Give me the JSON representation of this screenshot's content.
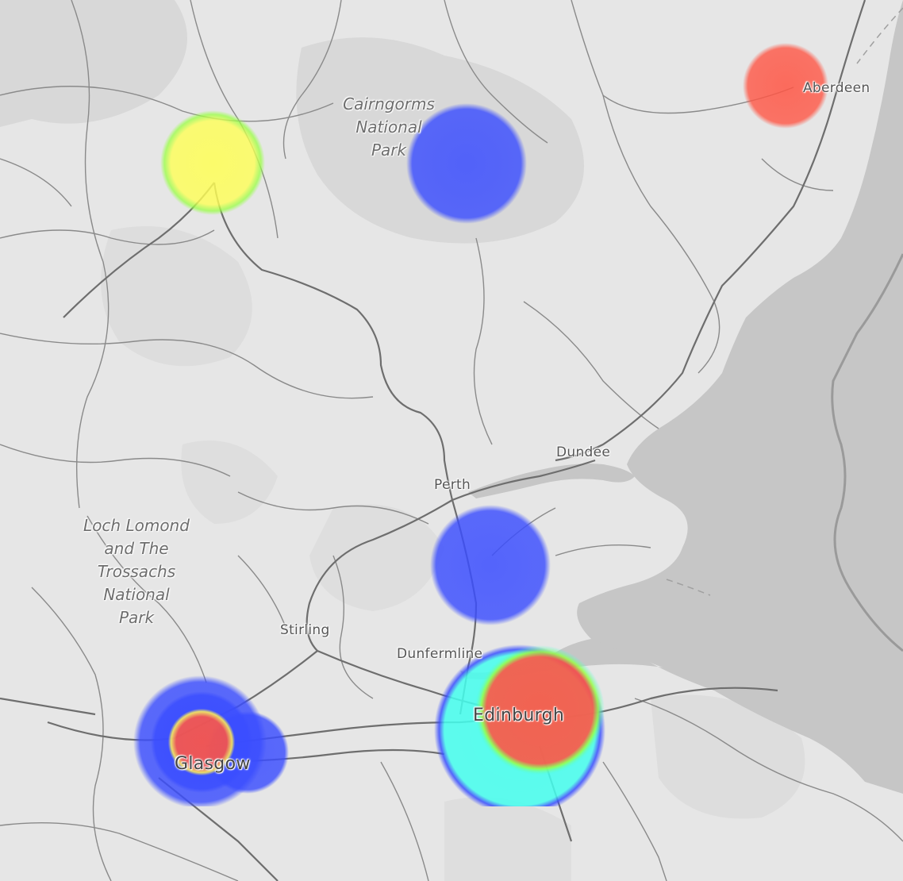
{
  "map": {
    "colors": {
      "land": "#e6e6e6",
      "sea": "#c6c6c6",
      "upland": "#d6d6d6",
      "road": "#8a8a8a",
      "motorway": "#666666",
      "heat_low": "#3a4dff",
      "heat_mid": "#44ffee",
      "heat_midhigh": "#99ff44",
      "heat_high_yellow": "#ffff55",
      "heat_max": "#ff5544"
    },
    "labels": {
      "aberdeen": "Aberdeen",
      "dundee": "Dundee",
      "perth": "Perth",
      "stirling": "Stirling",
      "dunfermline": "Dunfermline",
      "edinburgh": "Edinburgh",
      "glasgow": "Glasgow",
      "cairngorms": [
        "Cairngorms",
        "National",
        "Park"
      ],
      "loch_lomond": [
        "Loch Lomond",
        "and The",
        "Trossachs",
        "National",
        "Park"
      ]
    },
    "heat_points": [
      {
        "name": "Aberdeen hotspot",
        "level": "max"
      },
      {
        "name": "Highland hotspot",
        "level": "high"
      },
      {
        "name": "Cairngorms hotspot",
        "level": "low"
      },
      {
        "name": "Fife hotspot",
        "level": "low"
      },
      {
        "name": "Glasgow hotspot",
        "level": "max"
      },
      {
        "name": "Edinburgh hotspot",
        "level": "max"
      }
    ]
  }
}
